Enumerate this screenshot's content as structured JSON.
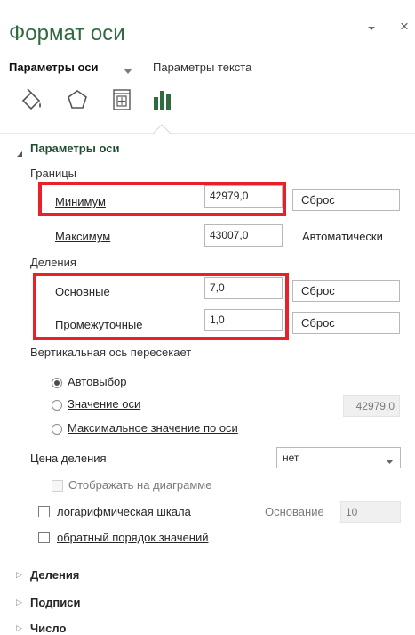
{
  "header": {
    "title": "Формат оси",
    "tab_axis": "Параметры оси",
    "tab_text": "Параметры текста"
  },
  "icons": [
    "paint-bucket-icon",
    "pentagon-icon",
    "size-properties-icon",
    "bar-chart-icon"
  ],
  "axis_options": {
    "section_title": "Параметры оси",
    "bounds": {
      "group": "Границы",
      "min_label": "Минимум",
      "min_value": "42979,0",
      "min_button": "Сброс",
      "max_label": "Максимум",
      "max_value": "43007,0",
      "max_state": "Автоматически"
    },
    "units": {
      "group": "Деления",
      "major_label": "Основные",
      "major_value": "7,0",
      "major_button": "Сброс",
      "minor_label": "Промежуточные",
      "minor_value": "1,0",
      "minor_button": "Сброс"
    },
    "crosses": {
      "group": "Вертикальная ось пересекает",
      "auto": "Автовыбор",
      "value": "Значение оси",
      "value_field": "42979,0",
      "max": "Максимальное значение по оси",
      "selected": "auto"
    },
    "display_units": {
      "label": "Цена деления",
      "selected": "нет",
      "show_on_chart": "Отображать на диаграмме"
    },
    "log_scale": {
      "label": "логарифмическая шкала",
      "base_label": "Основание",
      "base_value": "10"
    },
    "reverse": {
      "label": "обратный порядок значений"
    }
  },
  "collapsed_sections": [
    "Деления",
    "Подписи",
    "Число"
  ],
  "colors": {
    "accent": "#2e6b3f",
    "highlight": "#e8202a"
  }
}
